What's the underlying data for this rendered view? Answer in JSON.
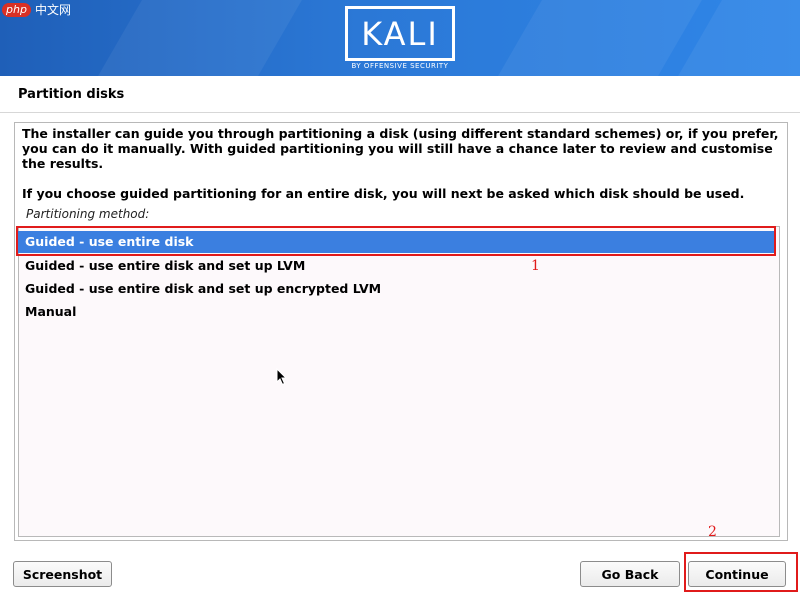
{
  "brand": {
    "logo_text": "KALI",
    "tagline": "BY OFFENSIVE SECURITY",
    "watermark_php": "php",
    "watermark_cn": "中文网"
  },
  "page": {
    "title": "Partition disks"
  },
  "description": {
    "paragraph1": "The installer can guide you through partitioning a disk (using different standard schemes) or, if you prefer, you can do it manually. With guided partitioning you will still have a chance later to review and customise the results.",
    "paragraph2": "If you choose guided partitioning for an entire disk, you will next be asked which disk should be used."
  },
  "partitioning": {
    "label": "Partitioning method:",
    "selected_index": 0,
    "options": [
      "Guided - use entire disk",
      "Guided - use entire disk and set up LVM",
      "Guided - use entire disk and set up encrypted LVM",
      "Manual"
    ]
  },
  "annotations": {
    "marker1": "1",
    "marker2": "2",
    "color": "#e01b1b"
  },
  "buttons": {
    "screenshot": "Screenshot",
    "go_back": "Go Back",
    "continue": "Continue"
  },
  "colors": {
    "banner": "#2b78d6",
    "selection": "#3b7fe0",
    "list_background": "#fdf9fb"
  }
}
